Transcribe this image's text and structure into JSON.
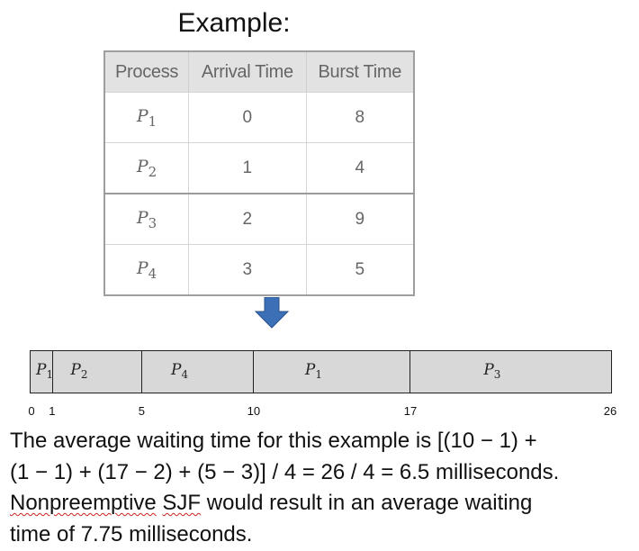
{
  "title": "Example:",
  "table": {
    "headers": [
      "Process",
      "Arrival Time",
      "Burst Time"
    ],
    "rows": [
      {
        "process": "P",
        "sub": "1",
        "arrival": "0",
        "burst": "8"
      },
      {
        "process": "P",
        "sub": "2",
        "arrival": "1",
        "burst": "4"
      },
      {
        "process": "P",
        "sub": "3",
        "arrival": "2",
        "burst": "9"
      },
      {
        "process": "P",
        "sub": "4",
        "arrival": "3",
        "burst": "5"
      }
    ]
  },
  "arrow_icon": "arrow-down-icon",
  "arrow_color": "#3b6fb6",
  "gantt": {
    "range": [
      0,
      26
    ],
    "blocks": [
      {
        "label": "P",
        "sub": "1",
        "start": 0,
        "end": 1
      },
      {
        "label": "P",
        "sub": "2",
        "start": 1,
        "end": 5
      },
      {
        "label": "P",
        "sub": "4",
        "start": 5,
        "end": 10
      },
      {
        "label": "P",
        "sub": "1",
        "start": 10,
        "end": 17
      },
      {
        "label": "P",
        "sub": "3",
        "start": 17,
        "end": 26
      }
    ],
    "ticks": [
      "0",
      "1",
      "5",
      "10",
      "17",
      "26"
    ]
  },
  "description": {
    "line1": "The average waiting time for this example is [(10 − 1) +",
    "line2": "(1 − 1) + (17 − 2) + (5 − 3)] / 4 = 26 / 4 = 6.5 milliseconds.",
    "line3_word1": "Nonpreemptive",
    "line3_word2": "SJF",
    "line3_rest": " would result in an average waiting",
    "line4": "time of 7.75 milliseconds."
  }
}
